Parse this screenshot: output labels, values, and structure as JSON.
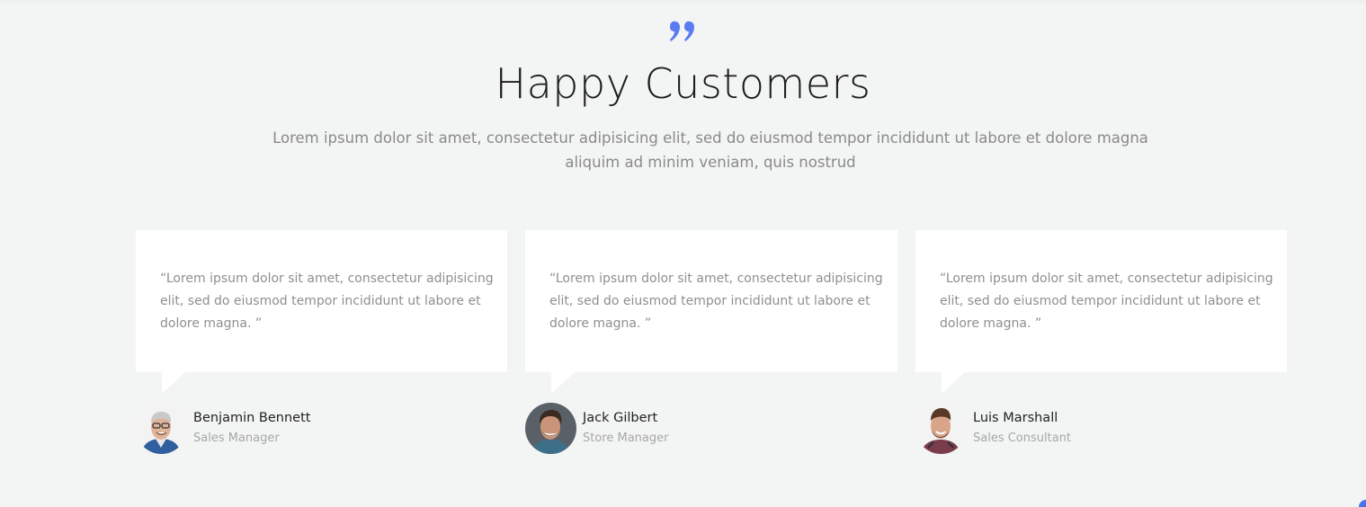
{
  "section": {
    "title": "Happy Customers",
    "subtitle": "Lorem ipsum dolor sit amet, consectetur adipisicing elit, sed do eiusmod tempor incididunt ut labore et dolore magna aliquim ad minim veniam, quis nostrud",
    "quote_icon": "quote-icon",
    "accent_color": "#5b7cf0"
  },
  "testimonials": [
    {
      "quote": "“Lorem ipsum dolor sit amet, consectetur adipisicing elit, sed do eiusmod tempor incididunt ut labore et dolore magna. ”",
      "name": "Benjamin Bennett",
      "role": "Sales Manager"
    },
    {
      "quote": "“Lorem ipsum dolor sit amet, consectetur adipisicing elit, sed do eiusmod tempor incididunt ut labore et dolore magna. ”",
      "name": "Jack Gilbert",
      "role": "Store Manager"
    },
    {
      "quote": "“Lorem ipsum dolor sit amet, consectetur adipisicing elit, sed do eiusmod tempor incididunt ut labore et dolore magna. ”",
      "name": "Luis Marshall",
      "role": "Sales Consultant"
    }
  ]
}
